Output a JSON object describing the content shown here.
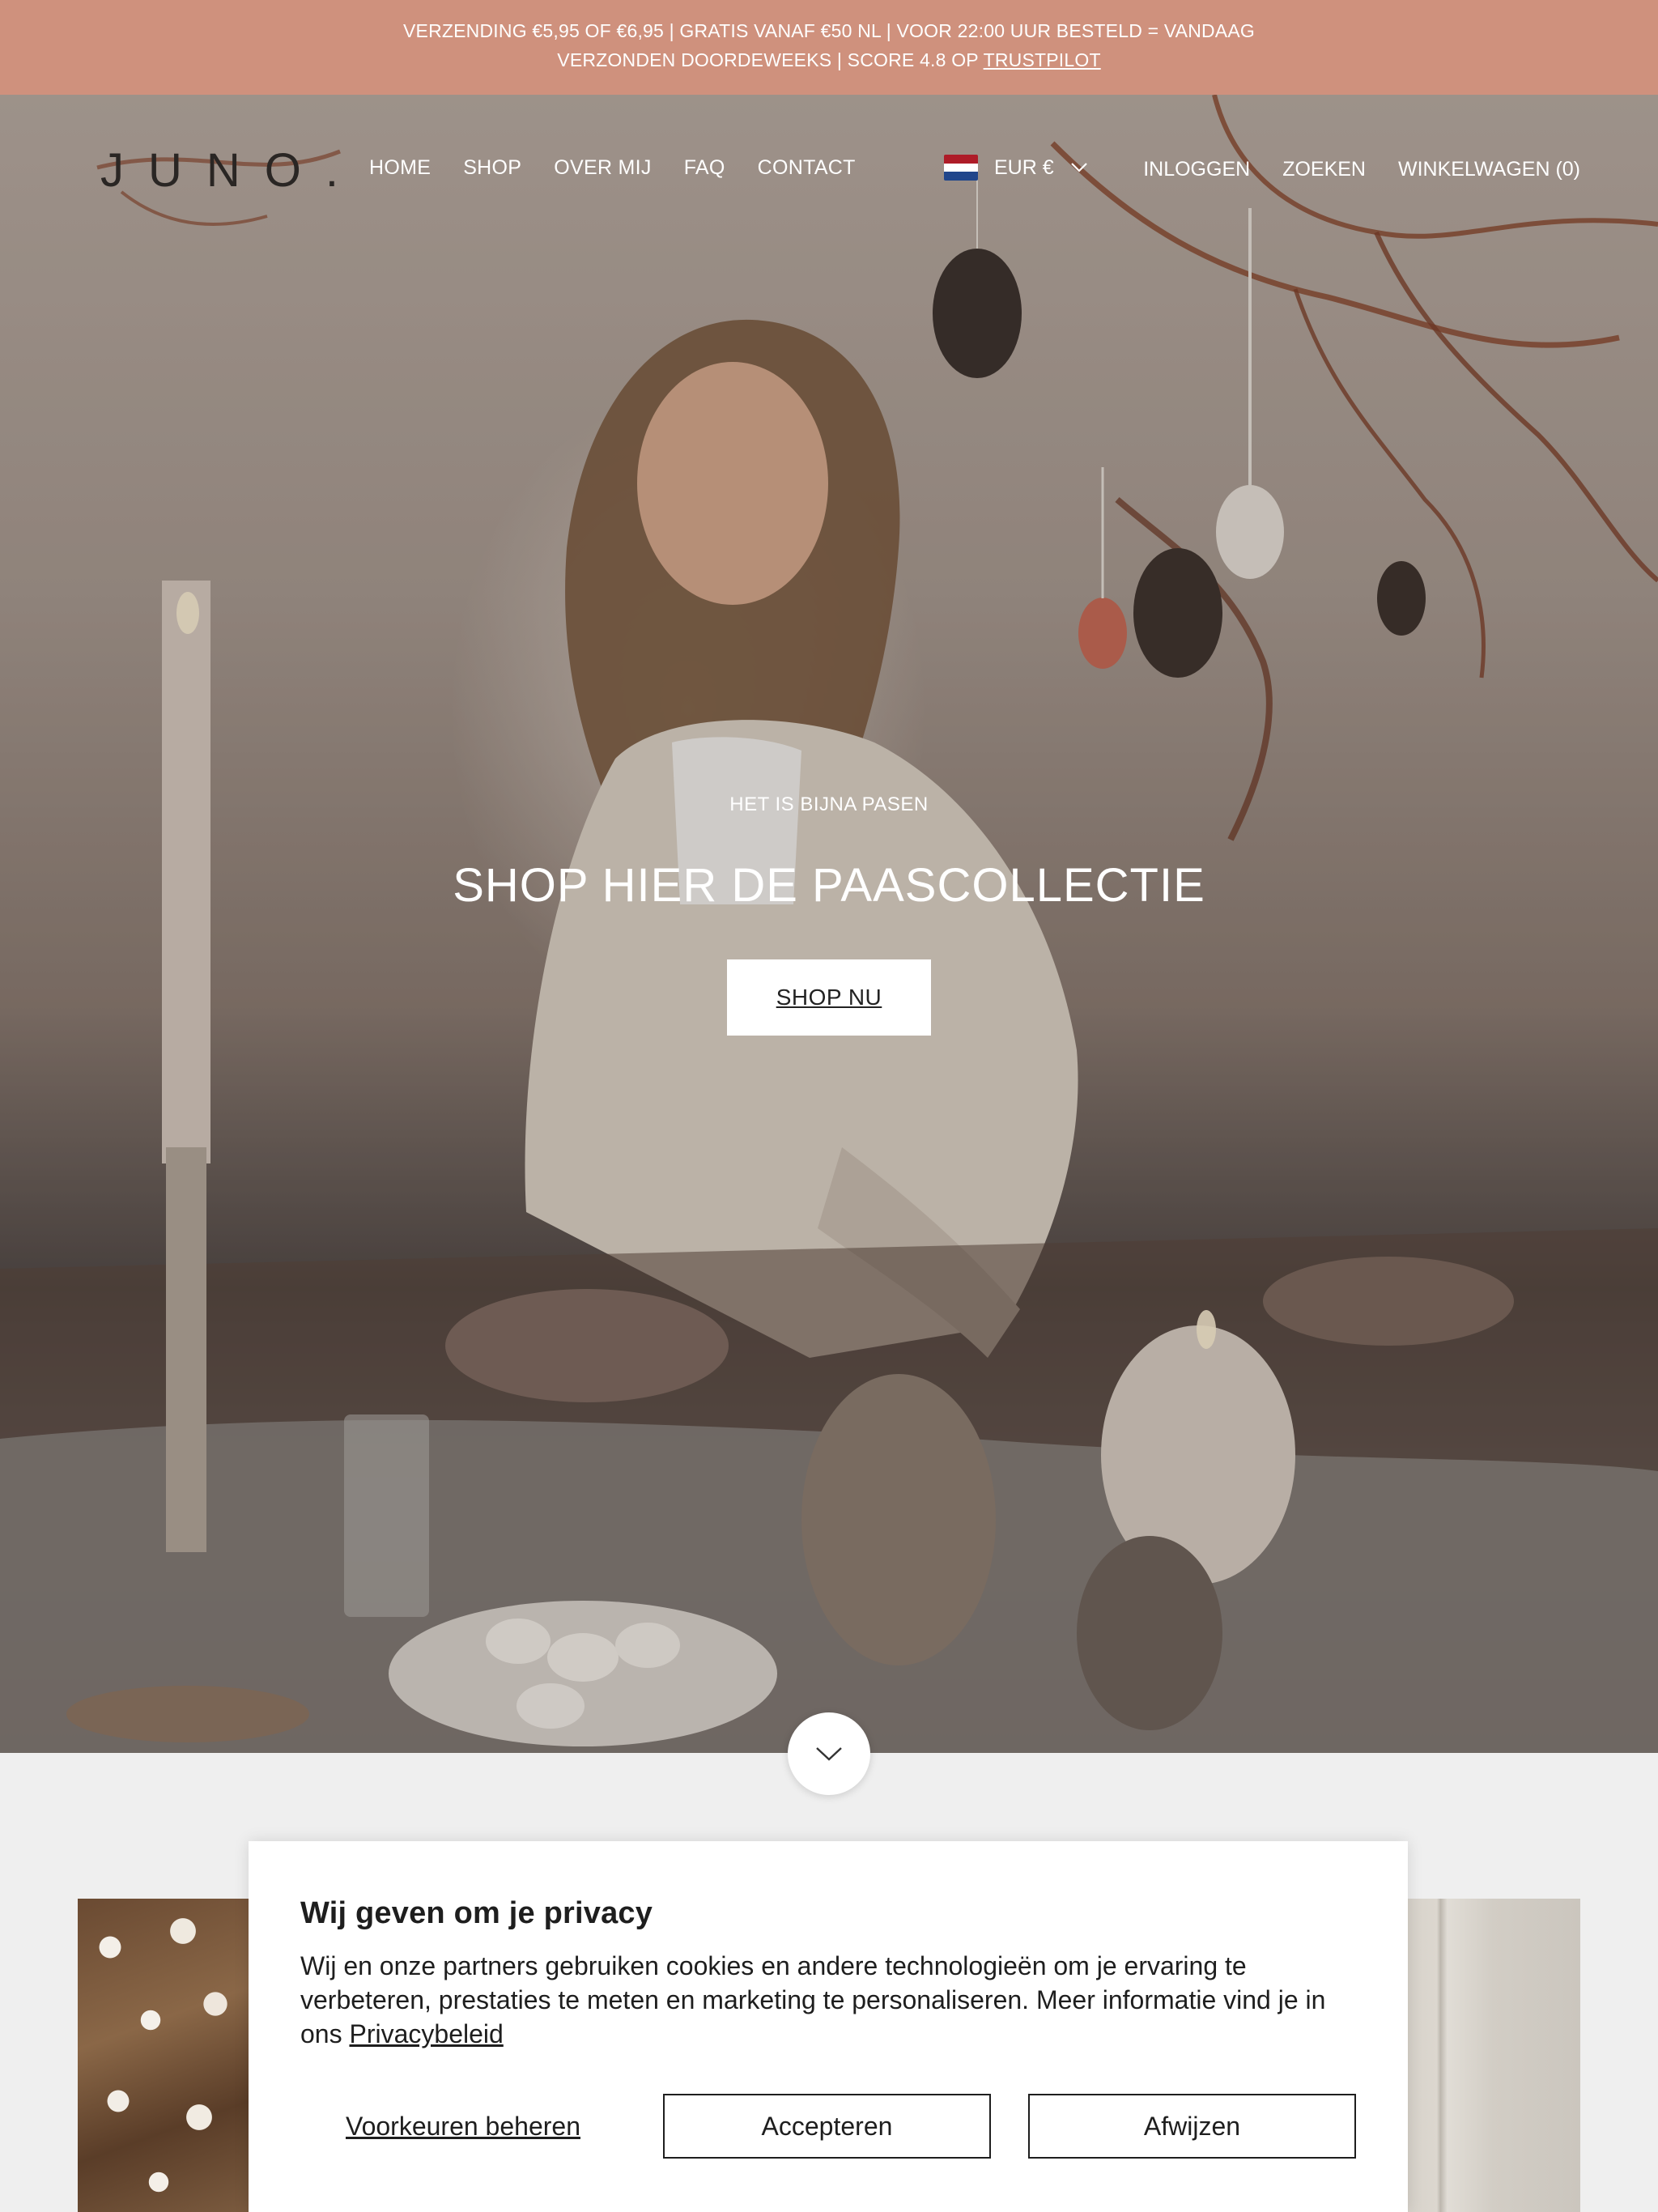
{
  "announcement": {
    "line1": "VERZENDING €5,95 OF €6,95 | GRATIS VANAF €50 NL | VOOR 22:00 UUR BESTELD = VANDAAG",
    "line2_prefix": "VERZONDEN DOORDEWEEKS | SCORE 4.8 OP ",
    "line2_link": "TRUSTPILOT",
    "bg_color": "#cf917d"
  },
  "header": {
    "logo": "JUNO.",
    "nav": [
      "HOME",
      "SHOP",
      "OVER MIJ",
      "FAQ",
      "CONTACT"
    ],
    "currency": {
      "label": "EUR €",
      "flag": "netherlands-flag-icon"
    },
    "login": "INLOGGEN",
    "search": "ZOEKEN",
    "cart": "WINKELWAGEN (0)"
  },
  "hero": {
    "eyebrow": "HET IS BIJNA PASEN",
    "title": "SHOP HIER DE PAASCOLLECTIE",
    "button": "SHOP NU",
    "scroll_icon": "chevron-down-icon"
  },
  "cookie": {
    "title": "Wij geven om je privacy",
    "text": "Wij en onze partners gebruiken cookies en andere technologieën om je ervaring te verbeteren, prestaties te meten en marketing te personaliseren. Meer informatie vind je in ons ",
    "link": "Privacybeleid",
    "manage": "Voorkeuren beheren",
    "accept": "Accepteren",
    "reject": "Afwijzen"
  }
}
